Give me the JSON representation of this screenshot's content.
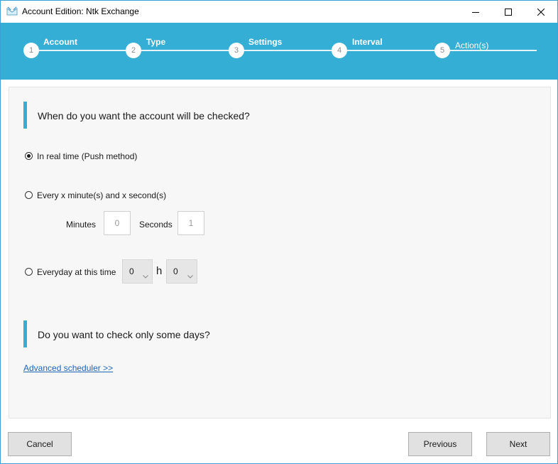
{
  "window": {
    "title": "Account Edition: Ntk Exchange",
    "icon": "envelope-app-icon",
    "controls": [
      "minimize-icon",
      "maximize-icon",
      "close-icon"
    ]
  },
  "wizard": {
    "accent_color": "#35aed6",
    "steps": [
      {
        "number": "1",
        "label": "Account",
        "state": "done"
      },
      {
        "number": "2",
        "label": "Type",
        "state": "done"
      },
      {
        "number": "3",
        "label": "Settings",
        "state": "done"
      },
      {
        "number": "4",
        "label": "Interval",
        "state": "current"
      },
      {
        "number": "5",
        "label": "Action(s)",
        "state": "pending"
      }
    ]
  },
  "section1": {
    "title": "When do you want the account will be checked?",
    "options": {
      "realtime": {
        "label": "In real time (Push method)",
        "checked": true
      },
      "every": {
        "label": "Every x minute(s) and x second(s)",
        "checked": false
      },
      "daily": {
        "label": "Everyday at this time",
        "checked": false
      }
    },
    "minutes_label": "Minutes",
    "minutes_value": "0",
    "seconds_label": "Seconds",
    "seconds_value": "1",
    "hour_value": "0",
    "hour_separator": "h",
    "minute_value": "0"
  },
  "section2": {
    "title": "Do you want to check only some days?",
    "link": "Advanced scheduler >>"
  },
  "buttons": {
    "cancel": "Cancel",
    "previous": "Previous",
    "next": "Next"
  }
}
